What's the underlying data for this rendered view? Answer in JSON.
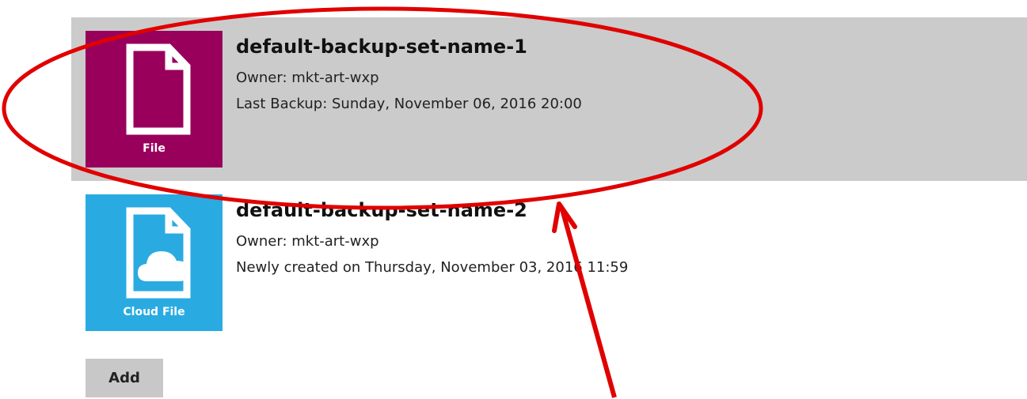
{
  "backup_sets": [
    {
      "name": "default-backup-set-name-1",
      "owner": "Owner: mkt-art-wxp",
      "status": "Last Backup: Sunday, November 06, 2016 20:00",
      "type_label": "File",
      "icon": "file-icon",
      "tile_color": "#98005c",
      "selected": true
    },
    {
      "name": "default-backup-set-name-2",
      "owner": "Owner: mkt-art-wxp",
      "status": "Newly created on Thursday, November 03, 2016 11:59",
      "type_label": "Cloud File",
      "icon": "cloud-file-icon",
      "tile_color": "#29abe2",
      "selected": false
    }
  ],
  "actions": {
    "add_label": "Add"
  },
  "annotation": {
    "color": "#e00000",
    "shapes": [
      "ellipse",
      "arrow"
    ]
  }
}
